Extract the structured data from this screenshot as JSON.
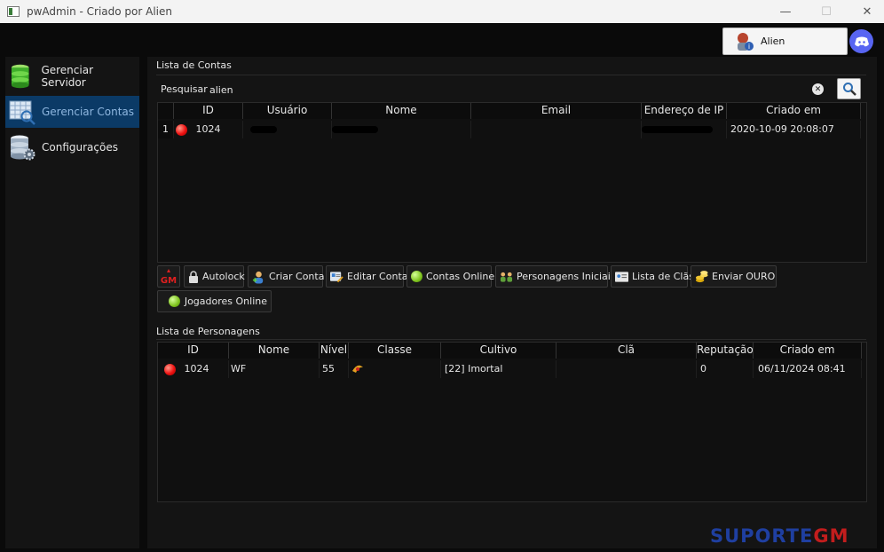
{
  "window": {
    "title": "pwAdmin - Criado por Alien",
    "minimize": "—",
    "maximize": "☐",
    "close": "✕"
  },
  "user": {
    "name": "Alien"
  },
  "sidebar": {
    "items": [
      {
        "label": "Gerenciar Servidor",
        "icon": "database-icon"
      },
      {
        "label": "Gerenciar Contas",
        "icon": "accounts-grid-icon",
        "active": true
      },
      {
        "label": "Configurações",
        "icon": "database-gear-icon"
      }
    ]
  },
  "accounts": {
    "section_label": "Lista de Contas",
    "search_label": "Pesquisar",
    "search_value": "alien",
    "columns": [
      "ID",
      "Usuário",
      "Nome",
      "Email",
      "Endereço de IP",
      "Criado em"
    ],
    "rows": [
      {
        "index": "1",
        "id": "1024",
        "usuario": "",
        "nome": "",
        "email": "",
        "ip": "",
        "criado": "2020-10-09 20:08:07"
      }
    ]
  },
  "toolbar": {
    "gm_label": "GM",
    "buttons": [
      {
        "label": "Autolock",
        "icon": "lock-icon"
      },
      {
        "label": "Criar Conta",
        "icon": "add-user-icon"
      },
      {
        "label": "Editar Conta",
        "icon": "edit-card-icon"
      },
      {
        "label": "Contas Online",
        "icon": "green-dot-icon"
      },
      {
        "label": "Personagens Iniciais",
        "icon": "characters-icon"
      },
      {
        "label": "Lista de Clãs",
        "icon": "id-card-icon"
      },
      {
        "label": "Enviar OURO",
        "icon": "gold-coins-icon"
      },
      {
        "label": "Jogadores Online",
        "icon": "green-dot-icon"
      }
    ]
  },
  "characters": {
    "section_label": "Lista de Personagens",
    "columns": [
      "ID",
      "Nome",
      "Nível",
      "Classe",
      "Cultivo",
      "Clã",
      "Reputação",
      "Criado em"
    ],
    "rows": [
      {
        "id": "1024",
        "nome": "WF",
        "nivel": "55",
        "classe": "",
        "cultivo": "[22] Imortal",
        "cla": "",
        "reputacao": "0",
        "criado": "06/11/2024 08:41"
      }
    ]
  },
  "watermark": {
    "text": "SUPORTE",
    "accent": "GM"
  },
  "colors": {
    "accent": "#0b3a66",
    "discord": "#5865f2",
    "watermark_blue": "#1f3fa0",
    "watermark_red": "#c21d1d"
  }
}
